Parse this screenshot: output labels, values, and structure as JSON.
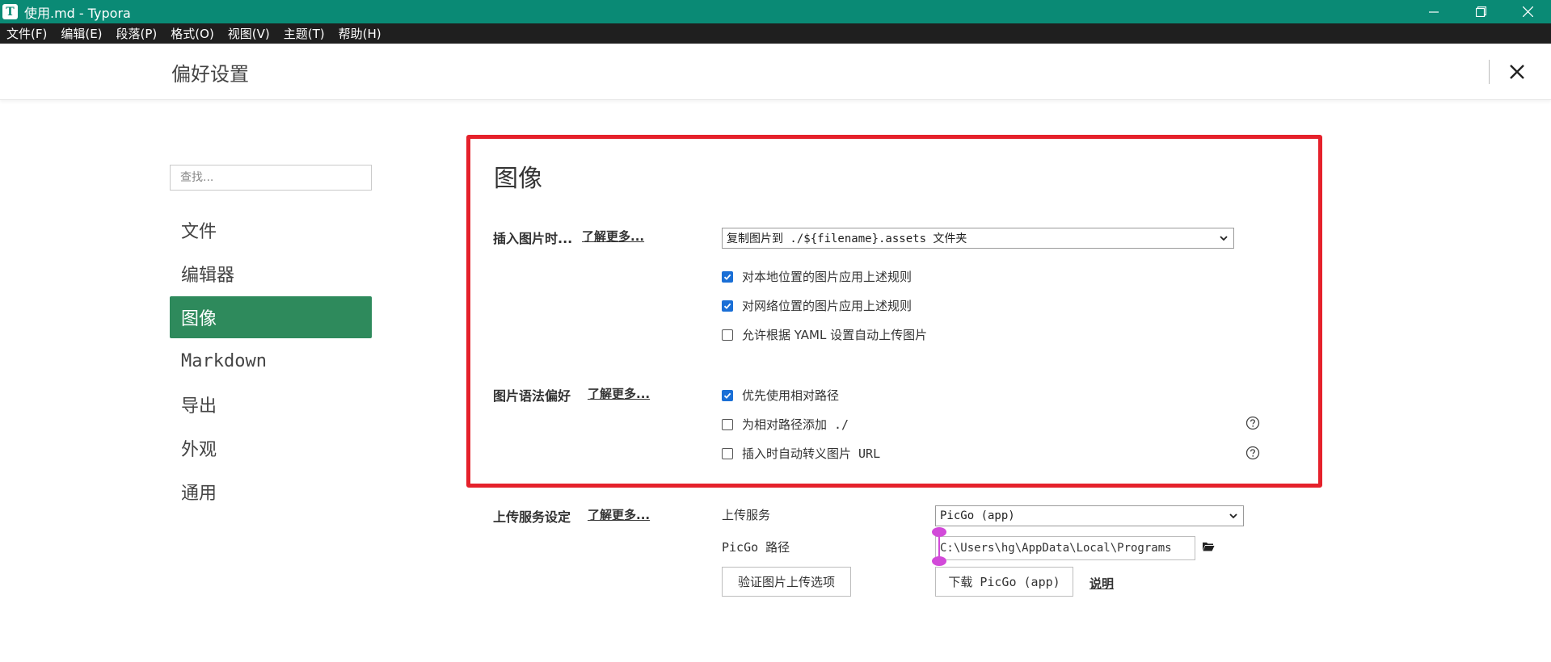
{
  "window": {
    "title": "使用.md - Typora",
    "app_icon_letter": "T"
  },
  "menubar": [
    "文件(F)",
    "编辑(E)",
    "段落(P)",
    "格式(O)",
    "视图(V)",
    "主题(T)",
    "帮助(H)"
  ],
  "prefs": {
    "title": "偏好设置"
  },
  "sidebar": {
    "search_placeholder": "查找...",
    "items": [
      "文件",
      "编辑器",
      "图像",
      "Markdown",
      "导出",
      "外观",
      "通用"
    ],
    "active_index": 2
  },
  "image_section": {
    "title": "图像",
    "insert": {
      "label": "插入图片时...",
      "learn_more": "了解更多...",
      "select_value": "复制图片到 ./${filename}.assets 文件夹",
      "checkboxes": [
        {
          "label": "对本地位置的图片应用上述规则",
          "checked": true
        },
        {
          "label": "对网络位置的图片应用上述规则",
          "checked": true
        },
        {
          "label": "允许根据 YAML 设置自动上传图片",
          "checked": false
        }
      ]
    },
    "syntax": {
      "label": "图片语法偏好",
      "learn_more": "了解更多...",
      "checkboxes": [
        {
          "label": "优先使用相对路径",
          "checked": true
        },
        {
          "label": "为相对路径添加 ./",
          "checked": false
        },
        {
          "label": "插入时自动转义图片 URL",
          "checked": false
        }
      ]
    },
    "upload": {
      "label": "上传服务设定",
      "learn_more": "了解更多...",
      "service_label": "上传服务",
      "service_value": "PicGo (app)",
      "path_label": "PicGo 路径",
      "path_value": "C:\\Users\\hg\\AppData\\Local\\Programs",
      "verify_button": "验证图片上传选项",
      "download_button": "下载 PicGo (app)",
      "doc_link": "说明"
    }
  },
  "colors": {
    "titlebar": "#0a8a75",
    "menubar": "#1f1f1f",
    "active_item": "#2e8a5c",
    "highlight_box": "#e5212b",
    "checkbox": "#1a6fd6"
  }
}
